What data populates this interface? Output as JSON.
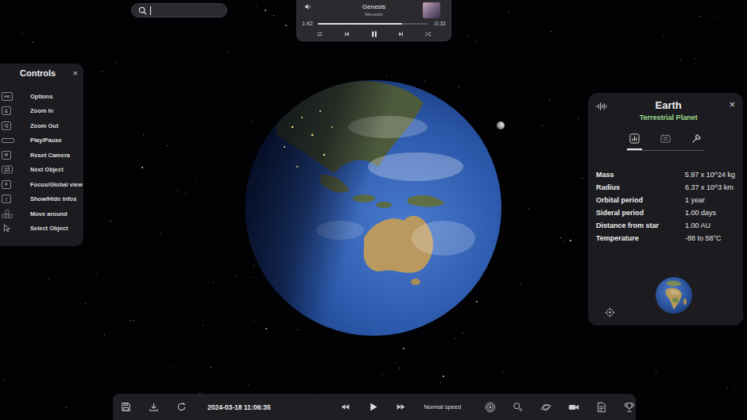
{
  "search": {
    "focused": true
  },
  "player": {
    "title": "Genesis",
    "artist": "Movediz",
    "elapsed": "1:42",
    "remaining": "-0:32",
    "level": 0.76,
    "playing": true
  },
  "controls": {
    "title": "Controls",
    "close": "×",
    "items": [
      {
        "kind": "key",
        "key": "esc",
        "label": "Options"
      },
      {
        "kind": "key",
        "key": "E",
        "label": "Zoom In"
      },
      {
        "kind": "key",
        "key": "Q",
        "label": "Zoom Out"
      },
      {
        "kind": "space",
        "label": "Play/Pause"
      },
      {
        "kind": "key",
        "key": "R",
        "label": "Reset Camera"
      },
      {
        "kind": "tab",
        "label": "Next Object"
      },
      {
        "kind": "key",
        "key": "F",
        "label": "Focus/Global view"
      },
      {
        "kind": "key",
        "key": "I",
        "label": "Show/Hide infos"
      },
      {
        "kind": "wasd",
        "label": "Move around"
      },
      {
        "kind": "cursor",
        "label": "Select Object"
      }
    ]
  },
  "info": {
    "title": "Earth",
    "subtitle": "Terrestrial Planet",
    "close": "×",
    "tabs": [
      {
        "kind": "chart",
        "selected": true
      },
      {
        "kind": "satellite",
        "selected": false
      },
      {
        "kind": "wrench",
        "selected": false
      }
    ],
    "properties": [
      {
        "label": "Mass",
        "value": "5.97 x 10^24 kg"
      },
      {
        "label": "Radius",
        "value": "6.37 x 10^3 km"
      },
      {
        "label": "Orbital period",
        "value": "1 year"
      },
      {
        "label": "Sideral period",
        "value": "1.00 days"
      },
      {
        "label": "Distance from star",
        "value": "1.00 AU"
      },
      {
        "label": "Temperature",
        "value": "-88 to 58°C"
      }
    ]
  },
  "toolbar": {
    "datetime": "2024-03-18 11:06:35",
    "speed": "Normal speed",
    "playing": false
  }
}
